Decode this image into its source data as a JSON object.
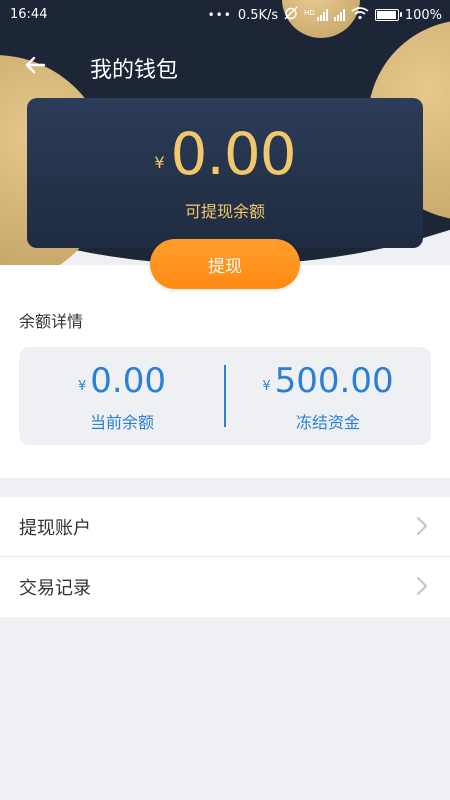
{
  "status_bar": {
    "time": "16:44",
    "network_speed": "0.5K/s",
    "hd_label": "HD",
    "battery": "100%"
  },
  "nav": {
    "back_icon": "arrow-left-icon",
    "title": "我的钱包"
  },
  "balance_card": {
    "currency_symbol": "¥",
    "amount": "0.00",
    "label": "可提现余额"
  },
  "withdraw_button": {
    "label": "提现"
  },
  "details": {
    "title": "余额详情",
    "current": {
      "currency_symbol": "¥",
      "amount": "0.00",
      "label": "当前余额"
    },
    "frozen": {
      "currency_symbol": "¥",
      "amount": "500.00",
      "label": "冻结资金"
    }
  },
  "menu": [
    {
      "label": "提现账户",
      "icon": "chevron-right-icon"
    },
    {
      "label": "交易记录",
      "icon": "chevron-right-icon"
    }
  ],
  "colors": {
    "header_dark": "#1d2637",
    "gold": "#c9a86a",
    "amount_gold": "#f1c96c",
    "accent_orange": "#ff9020",
    "detail_blue": "#2b7fd4",
    "background": "#eef0f3"
  }
}
